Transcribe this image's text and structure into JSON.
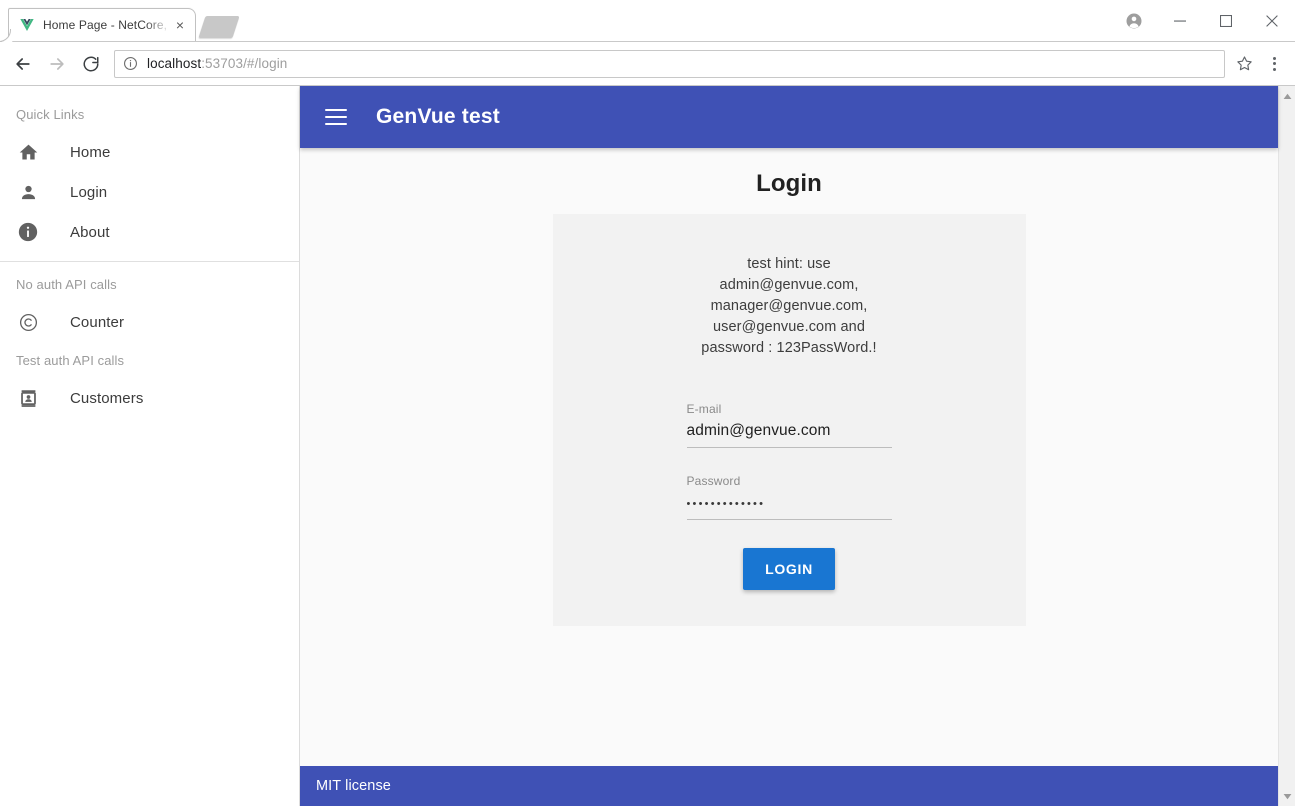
{
  "browser": {
    "tab": {
      "title": "Home Page - NetCore, Vu",
      "favicon_name": "vue-logo-icon",
      "close_label": "×"
    },
    "new_tab_label": "New tab",
    "window_controls": {
      "profile": "profile-avatar",
      "minimize": "–",
      "maximize": "□",
      "close": "✕"
    },
    "toolbar": {
      "back": "←",
      "forward": "→",
      "reload": "⟳",
      "url_host": "localhost",
      "url_rest": ":53703/#/login",
      "url_full": "localhost:53703/#/login",
      "site_info_icon": "info-circle-icon",
      "bookmark_icon": "star-icon",
      "menu_icon": "three-dot-menu-icon"
    }
  },
  "sidebar": {
    "sections": [
      {
        "header": "Quick Links",
        "items": [
          {
            "label": "Home",
            "icon": "home-icon"
          },
          {
            "label": "Login",
            "icon": "person-icon"
          },
          {
            "label": "About",
            "icon": "info-icon"
          }
        ]
      },
      {
        "header": "No auth API calls",
        "items": [
          {
            "label": "Counter",
            "icon": "copyright-icon"
          }
        ]
      },
      {
        "header": "Test auth API calls",
        "items": [
          {
            "label": "Customers",
            "icon": "contact-card-icon"
          }
        ]
      }
    ]
  },
  "appbar": {
    "menu_icon": "hamburger-menu-icon",
    "title": "GenVue test",
    "color": "#3f51b5"
  },
  "main": {
    "page_title": "Login",
    "hint_lines": [
      "test hint: use",
      "admin@genvue.com,",
      "manager@genvue.com,",
      "user@genvue.com and",
      "password : 123PassWord.!"
    ],
    "form": {
      "email": {
        "label": "E-mail",
        "value": "admin@genvue.com"
      },
      "password": {
        "label": "Password",
        "value": "•••••••••••••"
      },
      "submit_label": "LOGIN",
      "submit_color": "#1976d2"
    },
    "card_color": "#f2f2f2",
    "background_color": "#fafafa"
  },
  "footer": {
    "text": "MIT license"
  },
  "scrollbar": {
    "up": "▲",
    "down": "▼"
  }
}
